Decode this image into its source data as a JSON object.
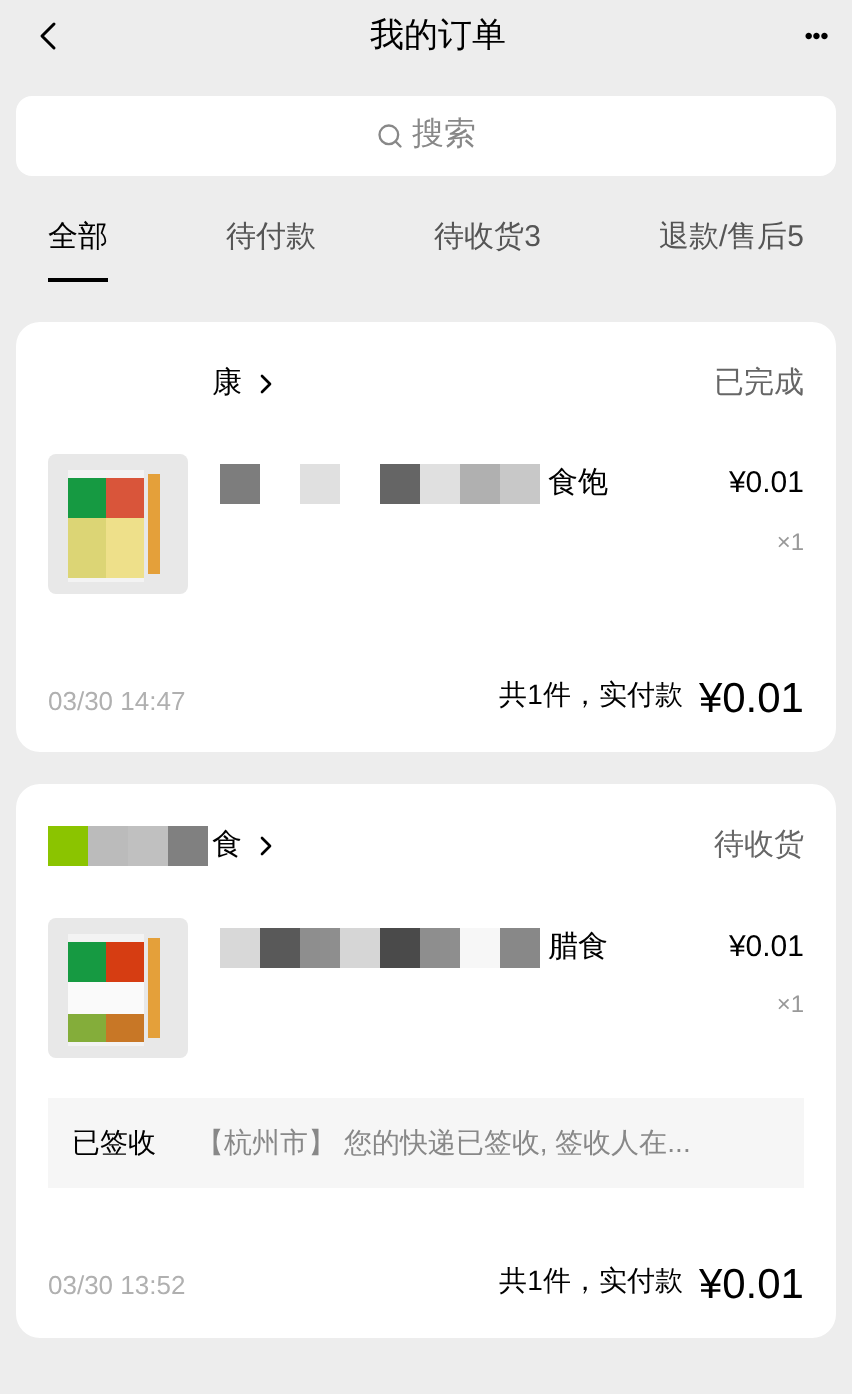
{
  "header": {
    "title": "我的订单",
    "more": "•••"
  },
  "search": {
    "placeholder": "搜索"
  },
  "tabs": [
    {
      "label": "全部",
      "selected": true
    },
    {
      "label": "待付款",
      "selected": false
    },
    {
      "label": "待收货3",
      "selected": false
    },
    {
      "label": "退款/售后5",
      "selected": false
    }
  ],
  "orders": [
    {
      "shop": "康",
      "status": "已完成",
      "product": {
        "title": "食饱",
        "price": "¥0.01",
        "qty": "×1"
      },
      "time": "03/30 14:47",
      "summary": "共1件，实付款",
      "total": "¥0.01"
    },
    {
      "shop": "食",
      "status": "待收货",
      "product": {
        "title": "腊食",
        "price": "¥0.01",
        "qty": "×1"
      },
      "tracking": {
        "state": "已签收",
        "text": "【杭州市】 您的快递已签收, 签收人在..."
      },
      "time": "03/30 13:52",
      "summary": "共1件，实付款",
      "total": "¥0.01"
    }
  ]
}
